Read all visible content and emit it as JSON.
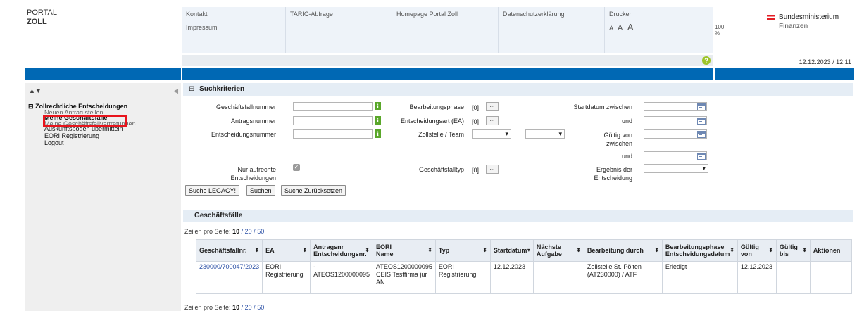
{
  "header": {
    "portal_line1": "PORTAL",
    "portal_line2": "ZOLL",
    "nav": {
      "kontakt": "Kontakt",
      "impressum": "Impressum",
      "taric": "TARIC-Abfrage",
      "homepage": "Homepage Portal Zoll",
      "datenschutz": "Datenschutzerklärung",
      "drucken": "Drucken",
      "font_small": "A",
      "font_medium": "A",
      "font_large": "A",
      "zoom": "100 %"
    },
    "help": "?",
    "datetime": "12.12.2023 / 12:11",
    "brand_line1": "Bundesministerium",
    "brand_line2": "Finanzen"
  },
  "sidebar": {
    "tools": "▲▼",
    "collapse": "◀",
    "root": "Zollrechtliche Entscheidungen",
    "root_toggle": "⊟",
    "items": [
      "Neuen Antrag stellen",
      "Meine Geschäftsfälle",
      "Meine Geschäftsfallvertretungen",
      "Auskunftsbogen übermitteln",
      "EORI Registrierung",
      "Logout"
    ]
  },
  "search": {
    "toggle": "⊟",
    "title": "Suchkriterien",
    "labels": {
      "fallnummer": "Geschäftsfallnummer",
      "antragsnummer": "Antragsnummer",
      "entscheidungsnummer": "Entscheidungsnummer",
      "nur_aufrechte_1": "Nur aufrechte",
      "nur_aufrechte_2": "Entscheidungen",
      "phase": "Bearbeitungsphase",
      "ea": "Entscheidungsart (EA)",
      "zollstelle": "Zollstelle / Team",
      "typ": "Geschäftsfalltyp",
      "startdatum": "Startdatum zwischen",
      "und1": "und",
      "gueltig_1": "Gültig von",
      "gueltig_2": "zwischen",
      "und2": "und",
      "ergebnis_1": "Ergebnis der",
      "ergebnis_2": "Entscheidung"
    },
    "counts": {
      "phase": "[0]",
      "ea": "[0]",
      "typ": "[0]"
    },
    "dots": "...",
    "info": "i",
    "checkbox": "✓",
    "buttons": {
      "legacy": "Suche LEGACY!",
      "suchen": "Suchen",
      "reset": "Suche Zurücksetzen"
    }
  },
  "results": {
    "title": "Geschäftsfälle",
    "pager_label": "Zeilen pro Seite:",
    "pager_10": "10",
    "pager_20": "20",
    "pager_50": "50",
    "pager_sep": "/",
    "columns": [
      "Geschäftsfallnr.",
      "EA",
      "Antragsnr",
      "Entscheidungsnr.",
      "EORI",
      "Name",
      "Typ",
      "Startdatum",
      "Nächste",
      "Aufgabe",
      "Bearbeitung durch",
      "Bearbeitungsphase",
      "Entscheidungsdatum",
      "Gültig",
      "von",
      "Gültig",
      "bis",
      "Aktionen"
    ],
    "row": {
      "fallnr": "230000/700047/2023",
      "ea_1": "EORI",
      "ea_2": "Registrierung",
      "antragsnr": "-",
      "entscheidungsnr": "ATEOS1200000095",
      "eori": "ATEOS1200000095",
      "name": "CEIS Testfirma jur AN",
      "typ_1": "EORI",
      "typ_2": "Registrierung",
      "startdatum": "12.12.2023",
      "bearbeitung": "Zollstelle St. Pölten (AT230000) / ATF",
      "phase": "Erledigt",
      "gueltig_von": "12.12.2023"
    }
  }
}
